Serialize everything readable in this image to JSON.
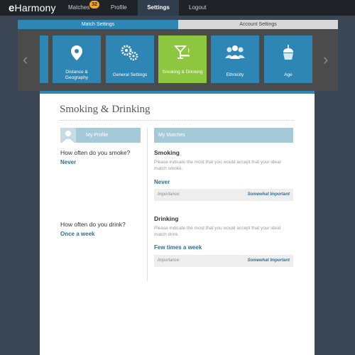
{
  "brand": {
    "logo_prefix": "e",
    "logo_name": "Harmony"
  },
  "nav": {
    "matches": "Matches",
    "matches_count": "32",
    "profile": "Profile",
    "settings": "Settings",
    "logout": "Logout"
  },
  "settings_tabs": {
    "match": "Match Settings",
    "account": "Account Settings"
  },
  "cards": [
    {
      "label": "Distance & Geography",
      "icon": "map-pin-icon"
    },
    {
      "label": "General Settings",
      "icon": "gears-icon"
    },
    {
      "label": "Smoking & Drinking",
      "icon": "cocktail-cigarette-icon"
    },
    {
      "label": "Ethnicity",
      "icon": "people-icon"
    },
    {
      "label": "Age",
      "icon": "cupcake-icon"
    }
  ],
  "arrows": {
    "prev": "‹",
    "next": "›"
  },
  "page": {
    "title": "Smoking & Drinking",
    "my_profile": "My Profile",
    "my_matches": "My Matches"
  },
  "smoking": {
    "question": "How often do you smoke?",
    "answer": "Never",
    "heading": "Smoking",
    "description": "Please indicate the most that you would accept that your ideal match smoke.",
    "match_value": "Never",
    "importance_label": "Importance:",
    "importance_value": "Somewhat Important"
  },
  "drinking": {
    "question": "How often do you drink?",
    "answer": "Once a week",
    "heading": "Drinking",
    "description": "Please indicate the most that you would accept that your ideal match drink.",
    "match_value": "Few times a week",
    "importance_label": "Importance:",
    "importance_value": "Somewhat Important"
  },
  "colors": {
    "accent_blue": "#2e86b4",
    "active_green": "#8dc63f",
    "header_blue": "#a6c9d8",
    "badge_orange": "#f5a623"
  }
}
